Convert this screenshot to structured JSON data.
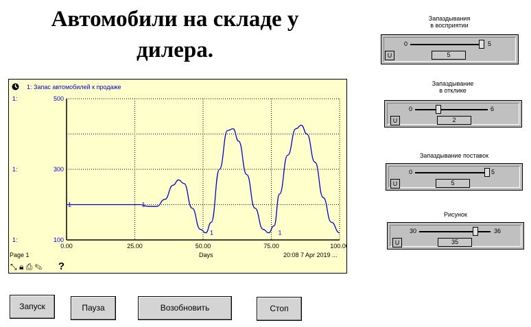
{
  "title": "Автомобили на складе у дилера.",
  "graph": {
    "legend": "1: Запас автомобилей к продаже",
    "y_axis_prefix": "1:",
    "page_label": "Page 1",
    "xlabel": "Days",
    "timestamp": "20:08   7 Apr 2019 ...",
    "help_icon": "?"
  },
  "chart_data": {
    "type": "line",
    "series": [
      {
        "name": "1: Запас автомобилей к продаже",
        "x": [
          0,
          25,
          27,
          30,
          33,
          36,
          39,
          41,
          43,
          46,
          49,
          51,
          53,
          56,
          59,
          61,
          63,
          66,
          69,
          72,
          74,
          76,
          78,
          81,
          84,
          86,
          88,
          91,
          94,
          97,
          100
        ],
        "y": [
          200,
          200,
          200,
          195,
          195,
          215,
          255,
          270,
          260,
          190,
          130,
          120,
          150,
          300,
          410,
          415,
          380,
          285,
          190,
          130,
          120,
          140,
          230,
          340,
          415,
          425,
          400,
          320,
          220,
          150,
          120
        ],
        "color": "#0000cc"
      }
    ],
    "xlim": [
      0,
      100
    ],
    "ylim": [
      100,
      500
    ],
    "x_ticks": [
      "0.00",
      "25.00",
      "50.00",
      "75.00",
      "100.00"
    ],
    "y_ticks": [
      "500",
      "300",
      "100"
    ],
    "grid": true,
    "series_markers": [
      {
        "x": 0,
        "y": 200,
        "label": "1"
      },
      {
        "x": 27,
        "y": 200,
        "label": "1"
      },
      {
        "x": 52,
        "y": 120,
        "label": "1"
      },
      {
        "x": 77,
        "y": 120,
        "label": "1"
      }
    ]
  },
  "sliders": [
    {
      "label": "Запаздывания\nв восприятии",
      "min": "0",
      "max": "5",
      "value": "5",
      "fraction": 1.0,
      "u": "U"
    },
    {
      "label": "Запаздывание\nв отклике",
      "min": "0",
      "max": "6",
      "value": "2",
      "fraction": 0.333,
      "u": "U"
    },
    {
      "label": "Запаздывание поставок",
      "min": "0",
      "max": "5",
      "value": "5",
      "fraction": 1.0,
      "u": "U"
    },
    {
      "label": "Рисунок",
      "min": "30",
      "max": "36",
      "value": "35",
      "fraction": 0.833,
      "u": "U"
    }
  ],
  "buttons": {
    "run": "Запуск",
    "pause": "Пауза",
    "resume": "Возобновить",
    "stop": "Стоп"
  },
  "colors": {
    "graph_bg": "#ffffcc",
    "series": "#0000cc",
    "panel": "#c0c0c0"
  }
}
